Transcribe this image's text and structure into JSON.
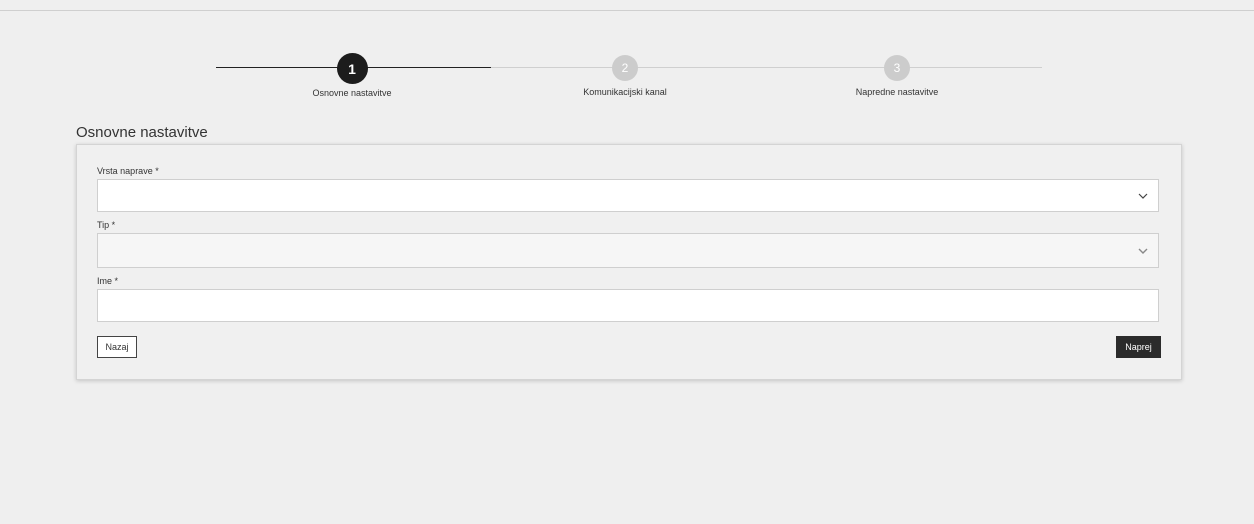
{
  "stepper": {
    "steps": [
      {
        "number": "1",
        "label": "Osnovne nastavitve"
      },
      {
        "number": "2",
        "label": "Komunikacijski kanal"
      },
      {
        "number": "3",
        "label": "Napredne nastavitve"
      }
    ]
  },
  "form": {
    "title": "Osnovne nastavitve",
    "device_type_label": "Vrsta naprave *",
    "type_label": "Tip *",
    "name_label": "Ime *"
  },
  "buttons": {
    "back": "Nazaj",
    "next": "Naprej"
  },
  "colors": {
    "active_step": "#1c1c1c",
    "inactive_step": "#cccccc",
    "primary_button": "#2b2b2b"
  }
}
